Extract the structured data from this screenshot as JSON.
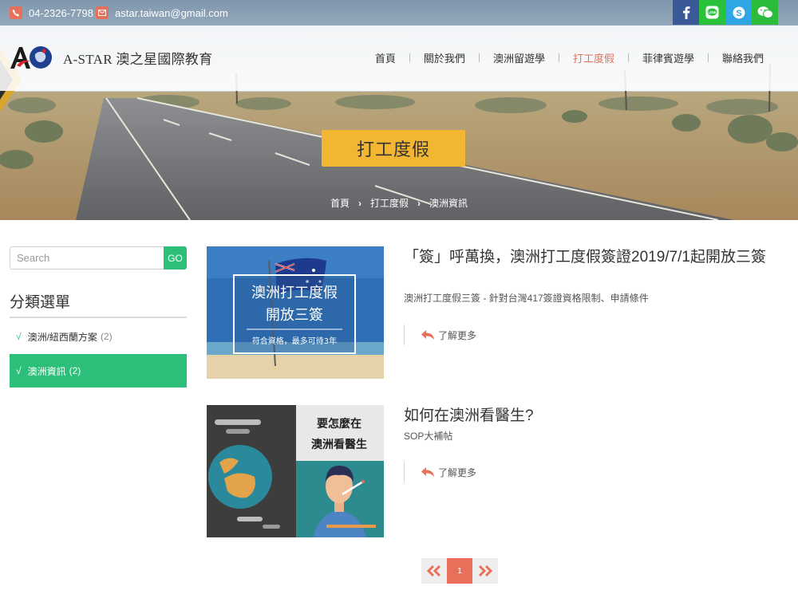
{
  "topbar": {
    "phone": "04-2326-7798",
    "email": "astar.taiwan@gmail.com",
    "social": [
      "facebook-icon",
      "line-icon",
      "skype-icon",
      "wechat-icon"
    ],
    "social_colors": [
      "#3b5998",
      "#29c23a",
      "#2ea5e5",
      "#2dbb3c"
    ]
  },
  "brand": {
    "name": "A-STAR 澳之星國際教育"
  },
  "nav": {
    "items": [
      "首頁",
      "關於我們",
      "澳洲留遊學",
      "打工度假",
      "菲律賓遊學",
      "聯絡我們"
    ]
  },
  "hero": {
    "title": "打工度假",
    "breadcrumb": [
      "首頁",
      "打工度假",
      "澳洲資訊"
    ]
  },
  "sidebar": {
    "search_placeholder": "Search",
    "go_label": "GO",
    "heading": "分類選單",
    "categories": [
      {
        "check": "√",
        "label": "澳洲/紐西蘭方案",
        "count": "(2)"
      },
      {
        "check": "√",
        "label": "澳洲資訊",
        "count": "(2)"
      }
    ]
  },
  "posts": [
    {
      "title": "「簽」呼萬換，澳洲打工度假簽證2019/7/1起開放三簽",
      "subtitle": "澳洲打工度假三簽 - 針對台灣417簽證資格限制、申請條件",
      "more": "了解更多",
      "thumb": {
        "line1": "澳洲打工度假",
        "line2": "開放三簽",
        "line3": "符合資格，最多可待3年"
      }
    },
    {
      "title": "如何在澳洲看醫生?",
      "subtitle": "SOP大補帖",
      "more": "了解更多",
      "thumb": {
        "line1": "要怎麼在",
        "line2": "澳洲看醫生"
      }
    }
  ],
  "pagination": {
    "current": "1"
  },
  "colors": {
    "accent": "#e8705a",
    "green": "#2dbf79",
    "yellow": "#f3b633"
  }
}
